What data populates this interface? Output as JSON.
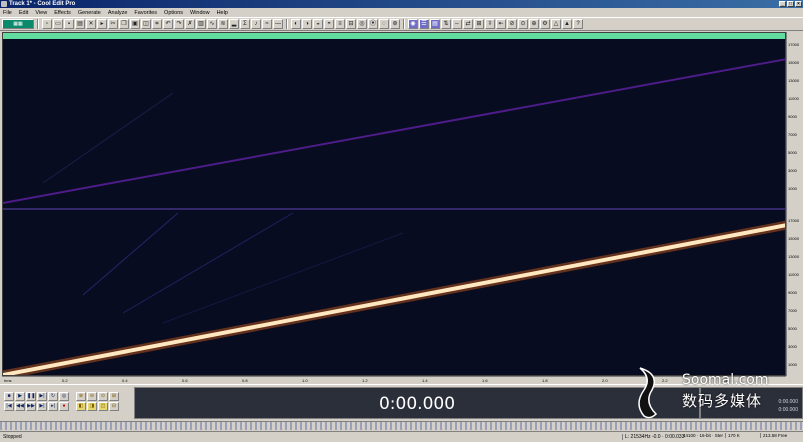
{
  "window": {
    "title": "Track 1* - Cool Edit Pro"
  },
  "menu": [
    "File",
    "Edit",
    "View",
    "Effects",
    "Generate",
    "Analyze",
    "Favorites",
    "Options",
    "Window",
    "Help"
  ],
  "timeline": {
    "current_time": "0:00.000"
  },
  "selection": {
    "begin": "0:00.000",
    "end": "0:00.000"
  },
  "status": {
    "state": "Stopped",
    "level": "L: 21534Hz -0.0 ·  0:00.033",
    "format": "44100 · 16-bit · Stereo",
    "size": "170 K",
    "free": "213.58 Free"
  },
  "watermark": {
    "en": "Soomal.com",
    "cn": "数码多媒体"
  },
  "colors": {
    "background": "#080c20",
    "overview": "#63dca0",
    "sweep": "#ffe7c0",
    "harmonic": "#5a1f9c"
  }
}
